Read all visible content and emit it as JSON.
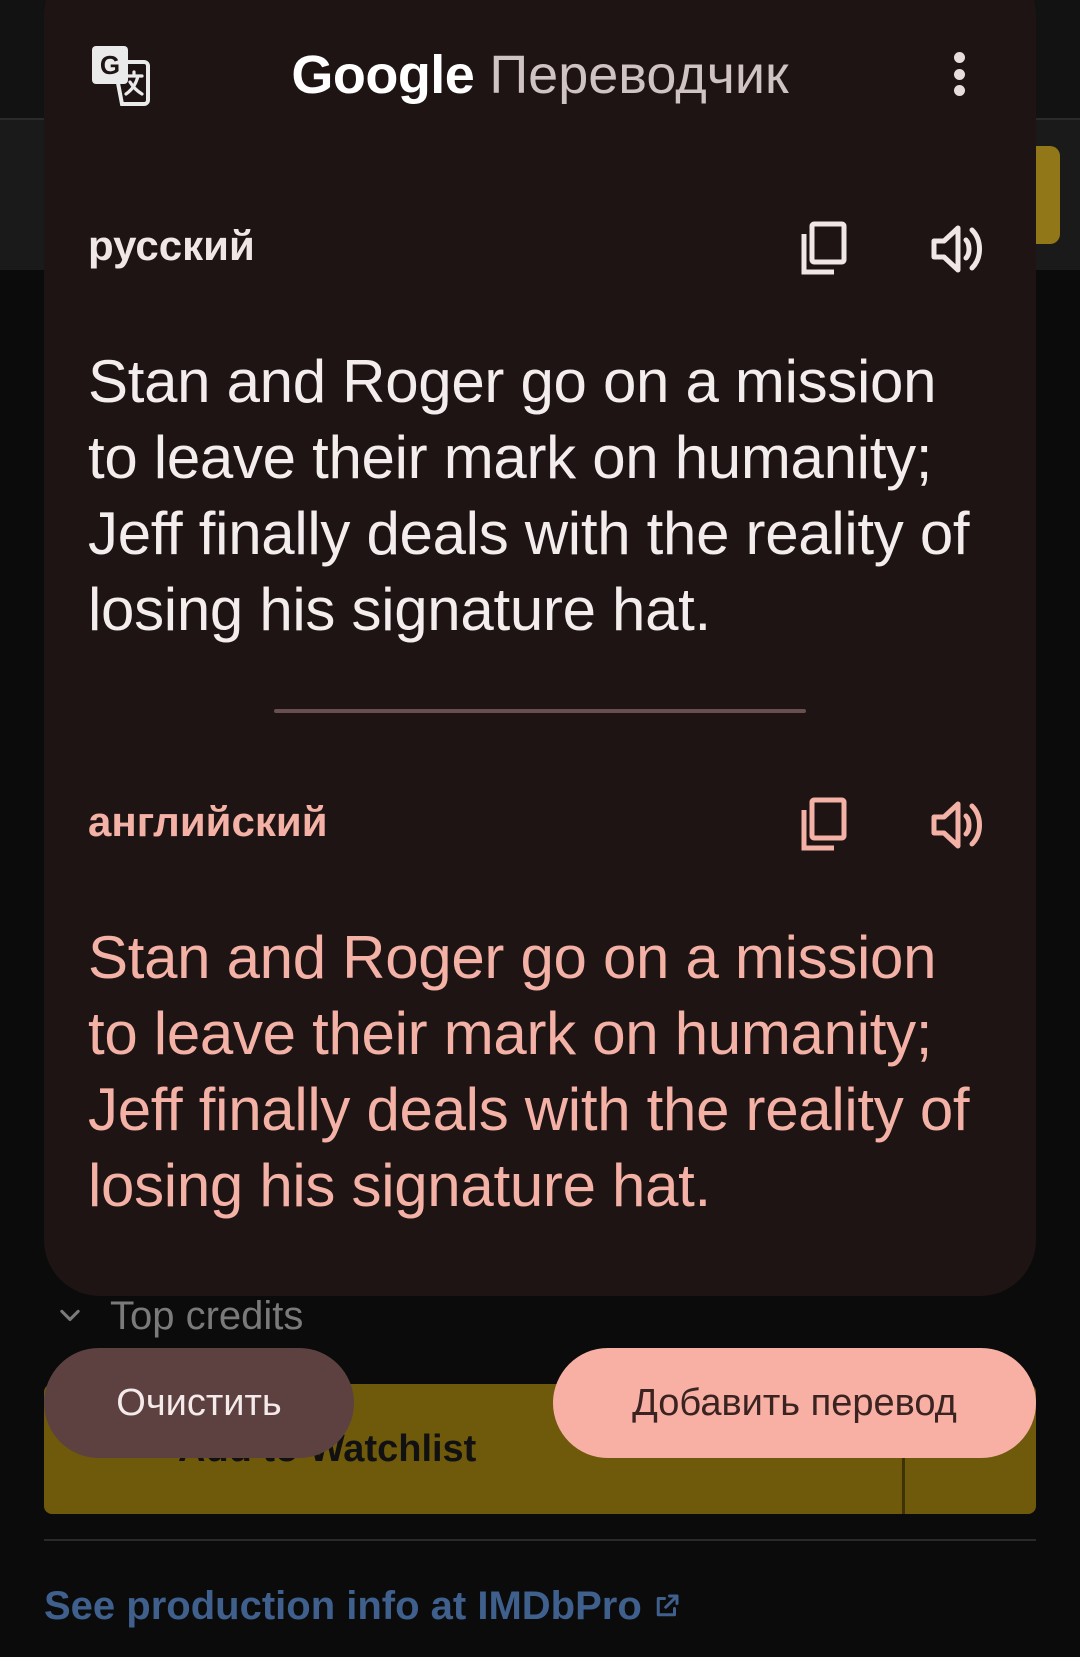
{
  "background": {
    "top_credits_label": "Top credits",
    "watchlist_label": "Add to Watchlist",
    "imdbpro_link": "See production info at IMDbPro"
  },
  "translate": {
    "brand": "Google",
    "product": "Переводчик",
    "source": {
      "language": "русский",
      "text": "Stan and Roger go on a mission to leave their mark on humanity; Jeff finally deals with the reality of losing his signature hat."
    },
    "target": {
      "language": "английский",
      "text": "Stan and Roger go on a mission to leave their mark on humanity; Jeff finally deals with the reality of losing his signature hat."
    },
    "buttons": {
      "clear": "Очистить",
      "add": "Добавить перевод"
    },
    "icons": {
      "app": "google-translate-icon",
      "menu": "more-vert-icon",
      "copy": "copy-icon",
      "speaker": "volume-icon",
      "chevron": "chevron-down-icon",
      "external": "external-link-icon"
    },
    "colors": {
      "card": "#1f1414",
      "accent": "#f4b1a6",
      "add_button": "#f7b0a3",
      "clear_button": "#5c4140",
      "watchlist": "#6f5a0c",
      "link": "#3f5f8c"
    }
  }
}
